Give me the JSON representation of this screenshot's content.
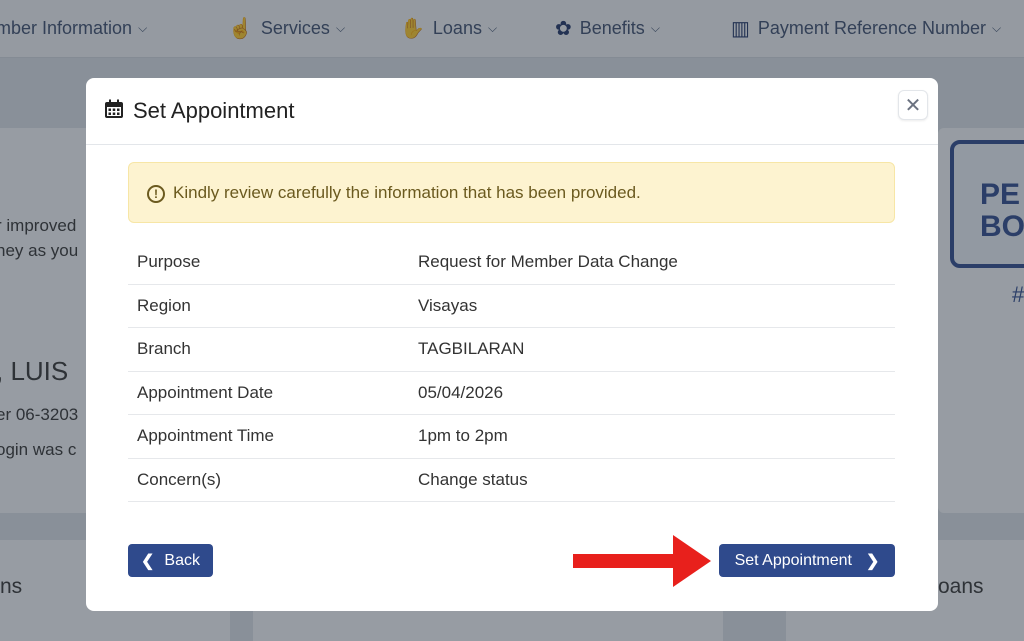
{
  "nav": {
    "items": [
      {
        "label": "mber Information",
        "icon": "member-icon"
      },
      {
        "label": "Services",
        "icon": "hand-pointer-icon"
      },
      {
        "label": "Loans",
        "icon": "loan-icon"
      },
      {
        "label": "Benefits",
        "icon": "benefits-icon"
      },
      {
        "label": "Payment Reference Number",
        "icon": "barcode-icon"
      }
    ]
  },
  "background": {
    "text1": "r improved",
    "text2": "ney as you",
    "name": ", LUIS",
    "number": "er 06-3203",
    "login": "ogin was c",
    "left_bottom": "ns",
    "right_bottom": "oans",
    "banner1": "PE",
    "banner2": "BO",
    "hash": "#"
  },
  "modal": {
    "title": "Set Appointment",
    "alert_text": "Kindly review carefully the information that has been provided.",
    "rows": [
      {
        "label": "Purpose",
        "value": "Request for Member Data Change"
      },
      {
        "label": "Region",
        "value": "Visayas"
      },
      {
        "label": "Branch",
        "value": "TAGBILARAN"
      },
      {
        "label": "Appointment Date",
        "value": "05/04/2026"
      },
      {
        "label": "Appointment Time",
        "value": "1pm to 2pm"
      },
      {
        "label": "Concern(s)",
        "value": "Change status"
      }
    ],
    "back_label": "Back",
    "set_label": "Set Appointment"
  },
  "colors": {
    "primary": "#2f4a8c",
    "alert_bg": "#fdf3d0",
    "annotation_arrow": "#e8201c"
  }
}
